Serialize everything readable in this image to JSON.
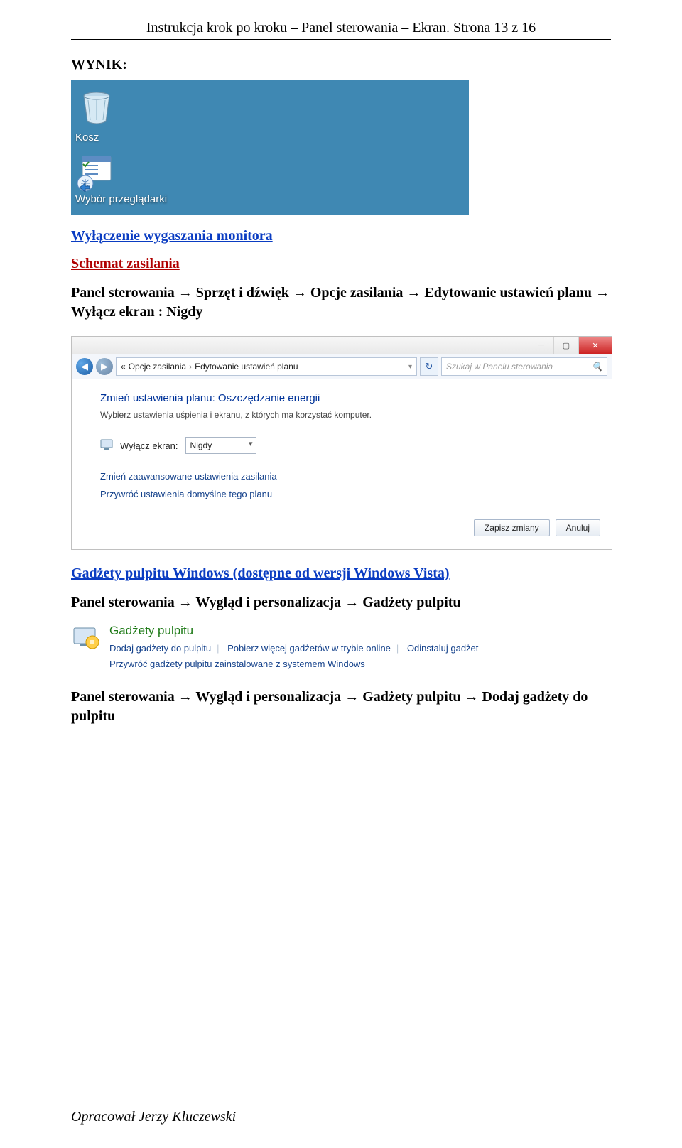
{
  "header": "Instrukcja krok po kroku – Panel sterowania – Ekran.  Strona 13 z 16",
  "result_label": "WYNIK:",
  "desktop": {
    "recycle_caption": "Kosz",
    "browser_caption": "Wybór przeglądarki"
  },
  "link_section1": "Wyłączenie wygaszania monitora",
  "link_section_power": "Schemat zasilania",
  "path_power": {
    "p1": "Panel sterowania",
    "p2": "Sprzęt i dźwięk",
    "p3": "Opcje zasilania",
    "p4": "Edytowanie ustawień planu",
    "p5": "Wyłącz ekran : Nigdy"
  },
  "window": {
    "crumb1": "Opcje zasilania",
    "crumb2": "Edytowanie ustawień planu",
    "search_placeholder": "Szukaj w Panelu sterowania",
    "heading": "Zmień ustawienia planu: Oszczędzanie energii",
    "sub": "Wybierz ustawienia uśpienia i ekranu, z których ma korzystać komputer.",
    "off_label": "Wyłącz ekran:",
    "off_value": "Nigdy",
    "adv_link": "Zmień zaawansowane ustawienia zasilania",
    "restore_link": "Przywróć ustawienia domyślne tego planu",
    "save": "Zapisz zmiany",
    "cancel": "Anuluj"
  },
  "link_section2": "Gadżety pulpitu Windows (dostępne od wersji Windows Vista)",
  "path_gadgets": {
    "p1": "Panel sterowania",
    "p2": "Wygląd i personalizacja",
    "p3": "Gadżety pulpitu"
  },
  "gadget_panel": {
    "title": "Gadżety pulpitu",
    "l1": "Dodaj gadżety do pulpitu",
    "l2": "Pobierz więcej gadżetów w trybie online",
    "l3": "Odinstaluj gadżet",
    "l4": "Przywróć gadżety pulpitu zainstalowane z systemem Windows"
  },
  "path_gadgets2": {
    "p1": "Panel sterowania",
    "p2": "Wygląd i personalizacja",
    "p3": "Gadżety pulpitu",
    "p4": "Dodaj gadżety do pulpitu"
  },
  "footer": "Opracował Jerzy Kluczewski"
}
